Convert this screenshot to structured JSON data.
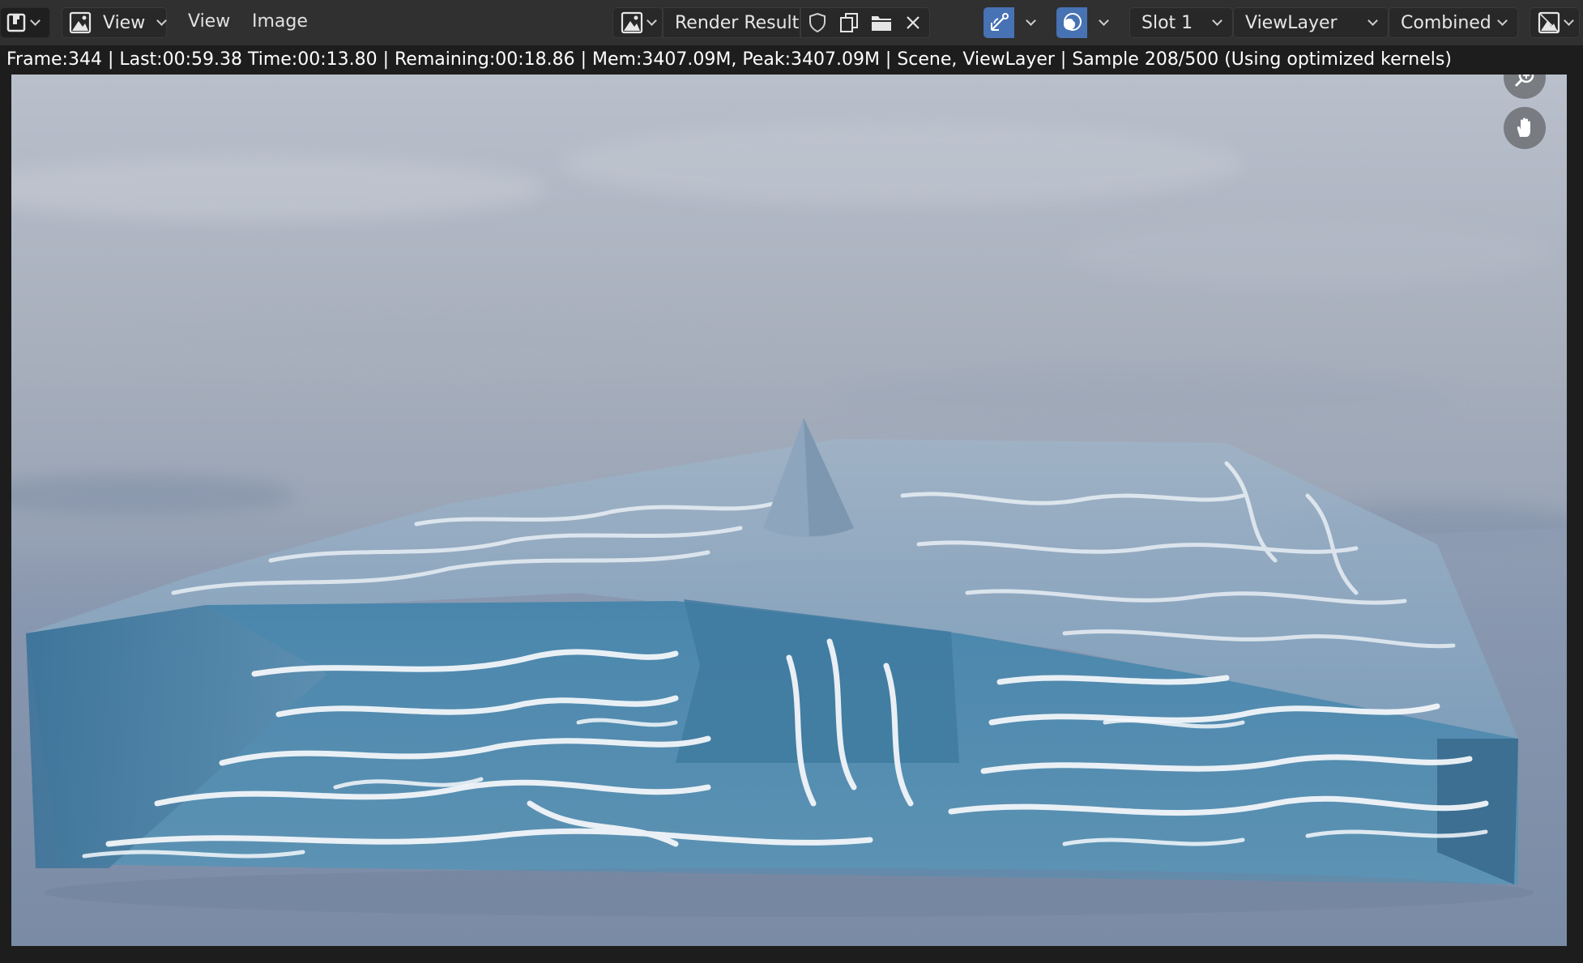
{
  "header": {
    "editor_type_icon": "image-editor-icon",
    "view_mode_icon": "image-view-icon",
    "view_mode_label": "View",
    "menus": [
      "View",
      "Image"
    ],
    "image_browse_icon": "image-browse-icon",
    "image_name": "Render Result",
    "fake_user_icon": "shield-icon",
    "duplicate_icon": "duplicate-icon",
    "open_icon": "folder-icon",
    "unlink_icon": "close-icon",
    "gizmo_icon": "gizmo-icon",
    "overlay_icon": "overlay-icon",
    "slot_label": "Slot 1",
    "layer_label": "ViewLayer",
    "pass_label": "Combined",
    "display_channels_icon": "display-channels-icon"
  },
  "status": {
    "text": "Frame:344 | Last:00:59.38 Time:00:13.80 | Remaining:00:18.86 | Mem:3407.09M, Peak:3407.09M | Scene, ViewLayer | Sample 208/500 (Using optimized kernels)"
  },
  "viewport": {
    "zoom_icon": "zoom-icon",
    "pan_icon": "hand-icon"
  }
}
